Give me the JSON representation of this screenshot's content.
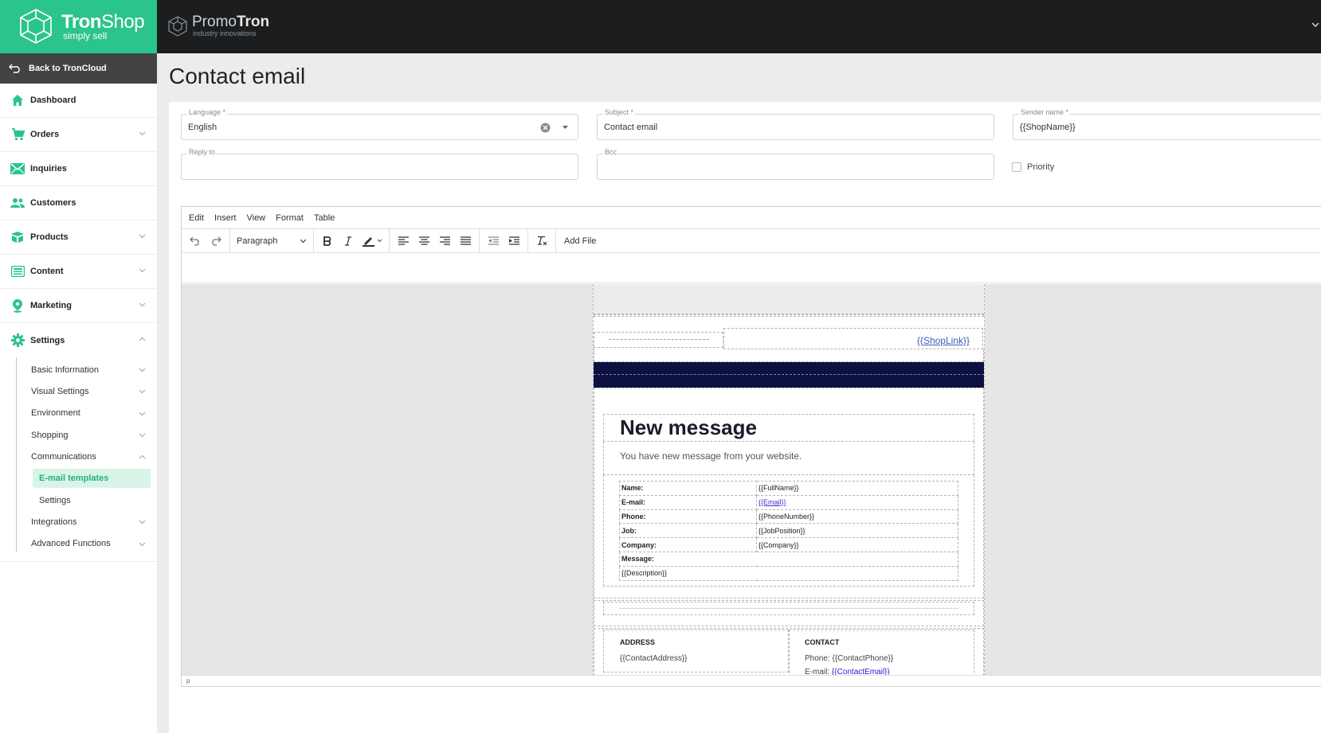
{
  "brand": {
    "name_bold": "Tron",
    "name_thin": "Shop",
    "tagline": "simply sell",
    "accent": "#2bc48a"
  },
  "partner": {
    "name_thin": "Promo",
    "name_bold": "Tron",
    "tagline": "industry innovations"
  },
  "sidebar": {
    "back_label": "Back to TronCloud",
    "items": [
      {
        "label": "Dashboard",
        "icon": "home-icon"
      },
      {
        "label": "Orders",
        "icon": "cart-icon"
      },
      {
        "label": "Inquiries",
        "icon": "envelope-icon"
      },
      {
        "label": "Customers",
        "icon": "users-icon"
      },
      {
        "label": "Products",
        "icon": "box-icon"
      },
      {
        "label": "Content",
        "icon": "content-icon"
      },
      {
        "label": "Marketing",
        "icon": "pin-icon"
      },
      {
        "label": "Settings",
        "icon": "gear-icon"
      }
    ],
    "settings_sub": [
      "Basic Information",
      "Visual Settings",
      "Environment",
      "Shopping",
      "Communications"
    ],
    "communications_sub": [
      "E-mail templates",
      "Settings"
    ],
    "settings_sub_after": [
      "Integrations",
      "Advanced Functions"
    ]
  },
  "page": {
    "title": "Contact email"
  },
  "form": {
    "language": {
      "label": "Language *",
      "value": "English"
    },
    "subject": {
      "label": "Subject *",
      "value": "Contact email"
    },
    "sender": {
      "label": "Sender name *",
      "value": "{{ShopName}}"
    },
    "reply_to": {
      "label": "Reply to",
      "value": ""
    },
    "bcc": {
      "label": "Bcc",
      "value": ""
    },
    "priority_label": "Priority"
  },
  "editor": {
    "menus": [
      "Edit",
      "Insert",
      "View",
      "Format",
      "Table"
    ],
    "block_format": "Paragraph",
    "add_file": "Add File",
    "status_path": "p"
  },
  "email": {
    "shop_link": "{{ShopLink}}",
    "headline": "New message",
    "subline": "You have new message from your website.",
    "rows": [
      {
        "k": "Name:",
        "v": "{{FullName}}"
      },
      {
        "k": "E-mail:",
        "v": "{{Email}}"
      },
      {
        "k": "Phone:",
        "v": "{{PhoneNumber}}"
      },
      {
        "k": "Job:",
        "v": "{{JobPosition}}"
      },
      {
        "k": "Company:",
        "v": "{{Company}}"
      },
      {
        "k": "Message:",
        "v": ""
      }
    ],
    "description": "{{Description}}",
    "address_head": "ADDRESS",
    "address_val": "{{ContactAddress}}",
    "contact_head": "CONTACT",
    "phone_prefix": "Phone: ",
    "phone_val": "{{ContactPhone}}",
    "email_prefix": "E-mail: ",
    "email_val": "{{ContactEmail}}"
  }
}
